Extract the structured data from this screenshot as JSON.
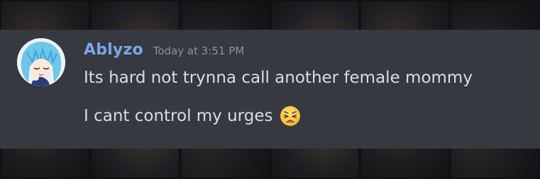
{
  "message": {
    "username": "Ablyzo",
    "timestamp": "Today at 3:51 PM",
    "lines": [
      {
        "text": "Its hard not trynna call another female mommy"
      },
      {
        "text": "I cant control my urges",
        "emoji": "weary-face-icon"
      }
    ]
  },
  "colors": {
    "panel_bg": "#36393f",
    "username": "#7ba6e6",
    "timestamp": "#8e9297",
    "text": "#dcddde"
  }
}
